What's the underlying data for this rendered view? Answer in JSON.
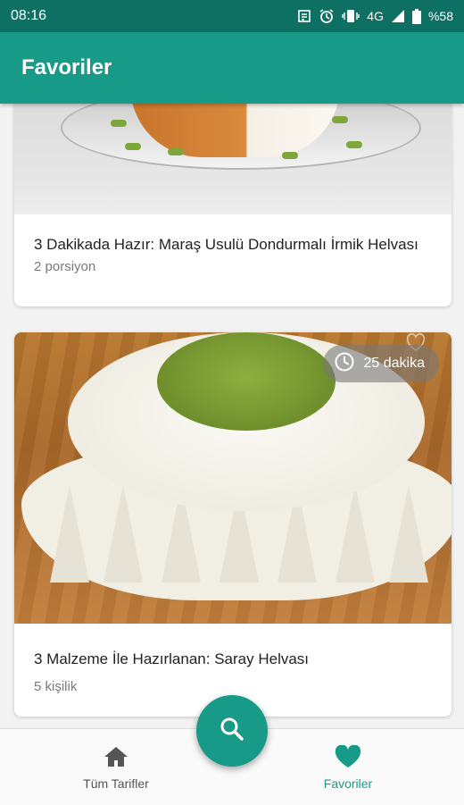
{
  "status": {
    "time": "08:16",
    "network": "4G",
    "battery": "%58"
  },
  "appbar": {
    "title": "Favoriler"
  },
  "recipes": [
    {
      "title": "3 Dakikada Hazır: Maraş Usulü Dondurmalı İrmik Helvası",
      "subtitle": "2 porsiyon"
    },
    {
      "title": "3 Malzeme İle Hazırlanan: Saray Helvası",
      "subtitle": "5 kişilik",
      "time": "25 dakika"
    }
  ],
  "nav": {
    "all_label": "Tüm Tarifler",
    "fav_label": "Favoriler"
  },
  "colors": {
    "primary": "#179a87",
    "primary_dark": "#0e6f63"
  },
  "icons": [
    "home-icon",
    "heart-icon",
    "search-icon",
    "clock-icon",
    "alarm-icon",
    "vibrate-icon",
    "signal-icon",
    "battery-icon"
  ]
}
